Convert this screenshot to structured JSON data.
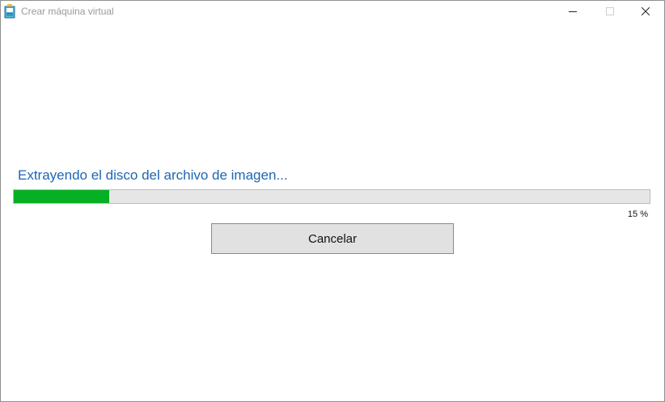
{
  "window": {
    "title": "Crear máquina virtual",
    "controls": {
      "minimize_icon": "minimize-icon",
      "maximize_icon": "maximize-icon",
      "close_icon": "close-icon"
    }
  },
  "main": {
    "status_text": "Extrayendo el disco del archivo de imagen...",
    "progress": {
      "value_percent": 15,
      "label": "15 %",
      "color": "#06b025"
    },
    "cancel_label": "Cancelar"
  },
  "colors": {
    "accent_text": "#1e66b4",
    "progress_track": "#e6e6e6",
    "progress_fill": "#06b025"
  }
}
